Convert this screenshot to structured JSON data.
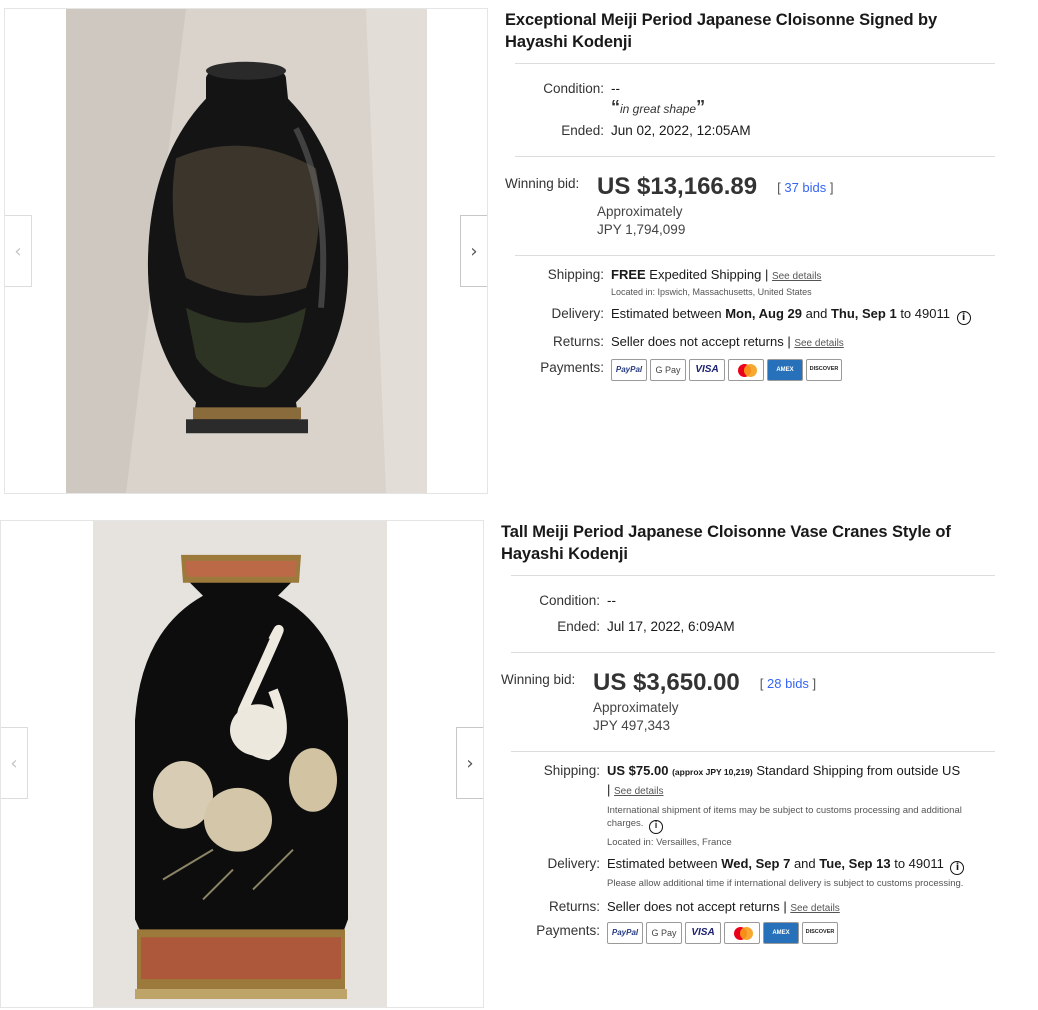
{
  "listings": [
    {
      "title": "Exceptional Meiji Period Japanese Cloisonne Signed by Hayashi Kodenji",
      "condition_label": "Condition:",
      "condition_value": "--",
      "condition_quote": "in great shape",
      "ended_label": "Ended:",
      "ended_value": "Jun 02, 2022, 12:05AM",
      "winning_label": "Winning bid:",
      "price": "US $13,166.89",
      "bids": "37 bids",
      "approx_label": "Approximately",
      "approx_value": "JPY 1,794,099",
      "shipping_label": "Shipping:",
      "shipping_free": "FREE",
      "shipping_text": "Expedited Shipping |",
      "see_details": "See details",
      "located": "Located in: Ipswich, Massachusetts, United States",
      "delivery_label": "Delivery:",
      "delivery_pre": "Estimated between",
      "delivery_start": "Mon, Aug 29",
      "delivery_and": "and",
      "delivery_end": "Thu, Sep 1",
      "delivery_to": "to 49011",
      "returns_label": "Returns:",
      "returns_text": "Seller does not accept returns |",
      "payments_label": "Payments:",
      "prev_arrow": "‹",
      "next_arrow": "›"
    },
    {
      "title": "Tall Meiji Period Japanese Cloisonne Vase Cranes Style of Hayashi Kodenji",
      "condition_label": "Condition:",
      "condition_value": "--",
      "ended_label": "Ended:",
      "ended_value": "Jul 17, 2022, 6:09AM",
      "winning_label": "Winning bid:",
      "price": "US $3,650.00",
      "bids": "28 bids",
      "approx_label": "Approximately",
      "approx_value": "JPY 497,343",
      "shipping_label": "Shipping:",
      "shipping_cost": "US $75.00",
      "shipping_approx": "(approx JPY 10,219)",
      "shipping_text": "Standard Shipping from outside US |",
      "see_details": "See details",
      "intl_note": "International shipment of items may be subject to customs processing and additional charges.",
      "located": "Located in: Versailles, France",
      "delivery_label": "Delivery:",
      "delivery_pre": "Estimated between",
      "delivery_start": "Wed, Sep 7",
      "delivery_and": "and",
      "delivery_end": "Tue, Sep 13",
      "delivery_to": "to 49011",
      "delivery_note": "Please allow additional time if international delivery is subject to customs processing.",
      "returns_label": "Returns:",
      "returns_text": "Seller does not accept returns |",
      "payments_label": "Payments:",
      "prev_arrow": "‹",
      "next_arrow": "›"
    }
  ],
  "payment_methods": {
    "paypal": "PayPal",
    "gpay": "G Pay",
    "visa": "VISA",
    "amex": "AMEX",
    "discover": "DISCOVER"
  },
  "icons": {
    "info": "i",
    "mastercard": "mastercard-icon"
  },
  "colors": {
    "link_blue": "#3665f3",
    "text": "#191919",
    "divider": "#dcdcdc"
  }
}
